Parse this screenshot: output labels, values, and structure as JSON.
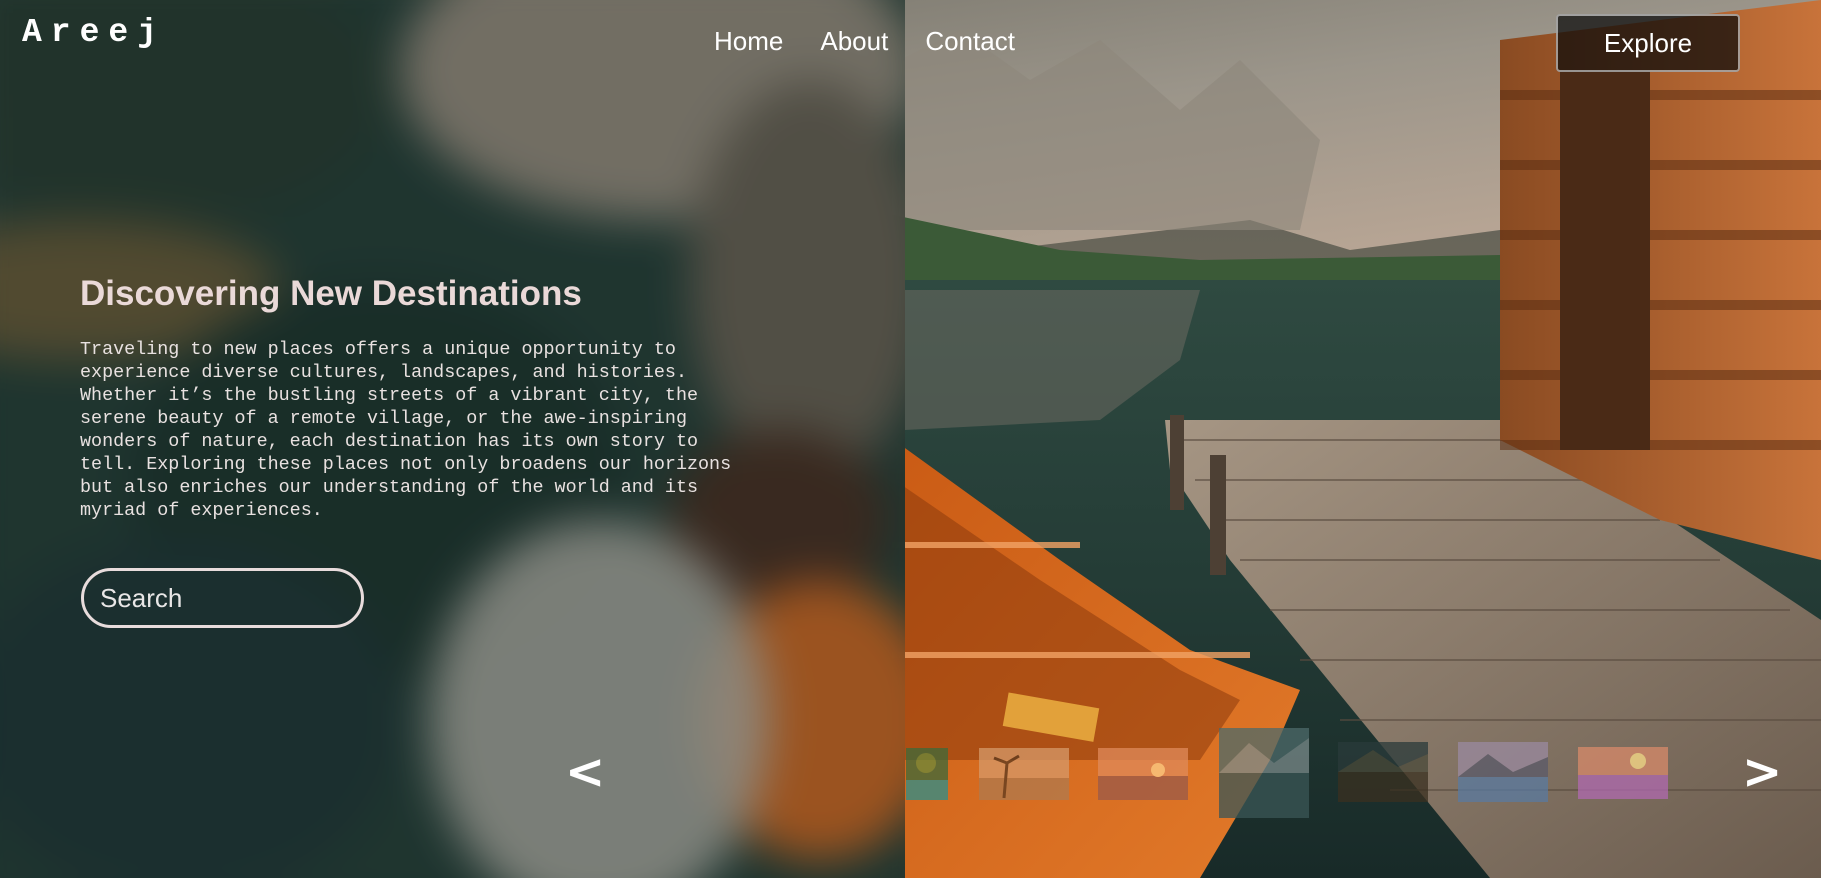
{
  "header": {
    "logo": "Areej",
    "nav": [
      "Home",
      "About",
      "Contact"
    ],
    "explore_label": "Explore"
  },
  "hero": {
    "title": "Discovering New Destinations",
    "body": "Traveling to new places offers a unique opportunity to experience diverse cultures, landscapes, and histories. Whether it’s the bustling streets of a vibrant city, the serene beauty of a remote village, or the awe-inspiring wonders of nature, each destination has its own story to tell. Exploring these places not only broadens our horizons but also enriches our understanding of the world and its myriad of experiences."
  },
  "search": {
    "placeholder": "Search"
  },
  "slider": {
    "prev_icon": "<",
    "next_icon": ">",
    "thumbnails": [
      "tropical-lagoon",
      "palm-beach-sunset",
      "beach-sunset",
      "mountain-lake-reflection",
      "night-mountain-lake",
      "alpine-lake-dusk",
      "flower-meadow-sunset"
    ]
  }
}
